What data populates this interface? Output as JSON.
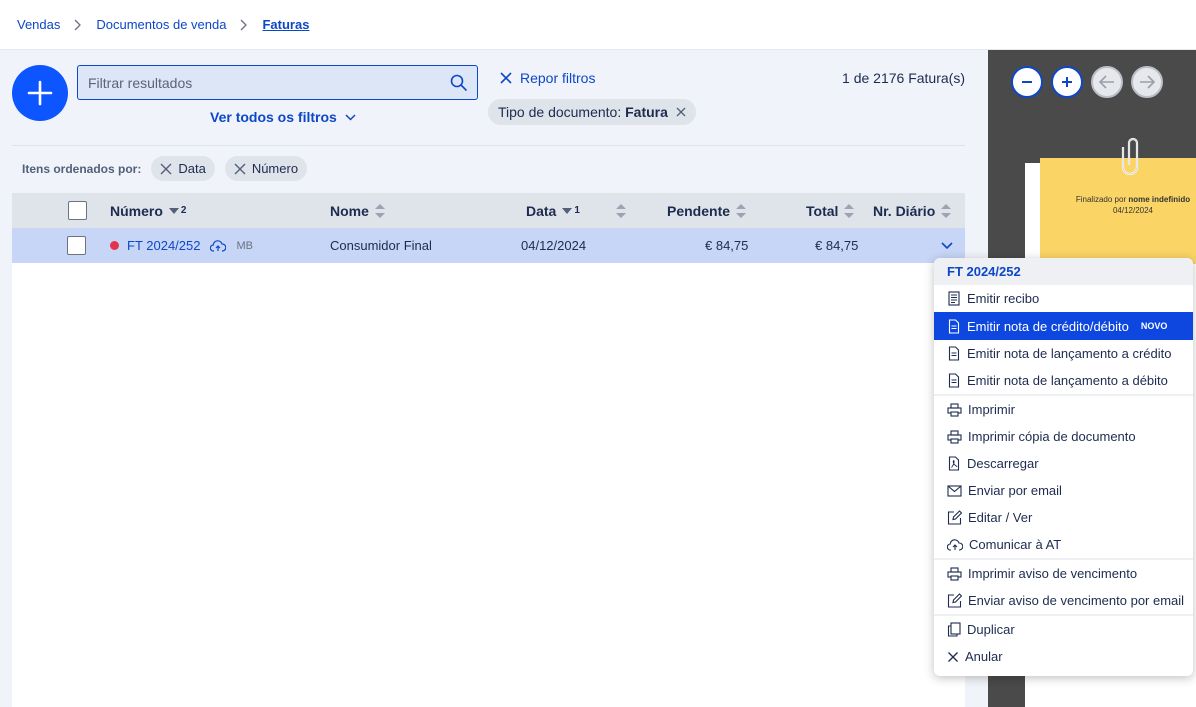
{
  "breadcrumb": {
    "items": [
      "Vendas",
      "Documentos de venda",
      "Faturas"
    ]
  },
  "toolbar": {
    "search_placeholder": "Filtrar resultados",
    "see_all_filters": "Ver todos os filtros",
    "reset_filters": "Repor filtros",
    "result_count": "1 de 2176 Fatura(s)",
    "filter_chip_label": "Tipo de documento:",
    "filter_chip_value": "Fatura"
  },
  "sort": {
    "label": "Itens ordenados por:",
    "chips": [
      "Data",
      "Número"
    ]
  },
  "table": {
    "columns": {
      "numero": "Número",
      "numero_sort_index": "2",
      "nome": "Nome",
      "data": "Data",
      "data_sort_index": "1",
      "pendente": "Pendente",
      "total": "Total",
      "diario": "Nr. Diário"
    },
    "rows": [
      {
        "numero": "FT 2024/252",
        "tag": "MB",
        "nome": "Consumidor Final",
        "data": "04/12/2024",
        "pendente": "€ 84,75",
        "total": "€ 84,75",
        "status_color": "#e5334b"
      }
    ]
  },
  "preview": {
    "note_prefix": "Finalizado por",
    "note_user": "nome indefinido",
    "note_date": "04/12/2024"
  },
  "menu": {
    "title": "FT 2024/252",
    "items": {
      "emitir_recibo": "Emitir recibo",
      "emitir_nota_credito_debito": "Emitir nota de crédito/débito",
      "novo_badge": "NOVO",
      "lancamento_credito": "Emitir nota de lançamento a crédito",
      "lancamento_debito": "Emitir nota de lançamento a débito",
      "imprimir": "Imprimir",
      "imprimir_copia": "Imprimir cópia de documento",
      "descarregar": "Descarregar",
      "enviar_email": "Enviar por email",
      "editar_ver": "Editar / Ver",
      "comunicar_at": "Comunicar à AT",
      "imprimir_aviso": "Imprimir aviso de vencimento",
      "enviar_aviso": "Enviar aviso de vencimento por email",
      "duplicar": "Duplicar",
      "anular": "Anular"
    }
  },
  "colors": {
    "accent": "#0d47c9",
    "fab": "#0d55ff",
    "selected_row": "#c7d6f6",
    "menu_active": "#0d47e0",
    "sticky_note": "#fbd466"
  }
}
